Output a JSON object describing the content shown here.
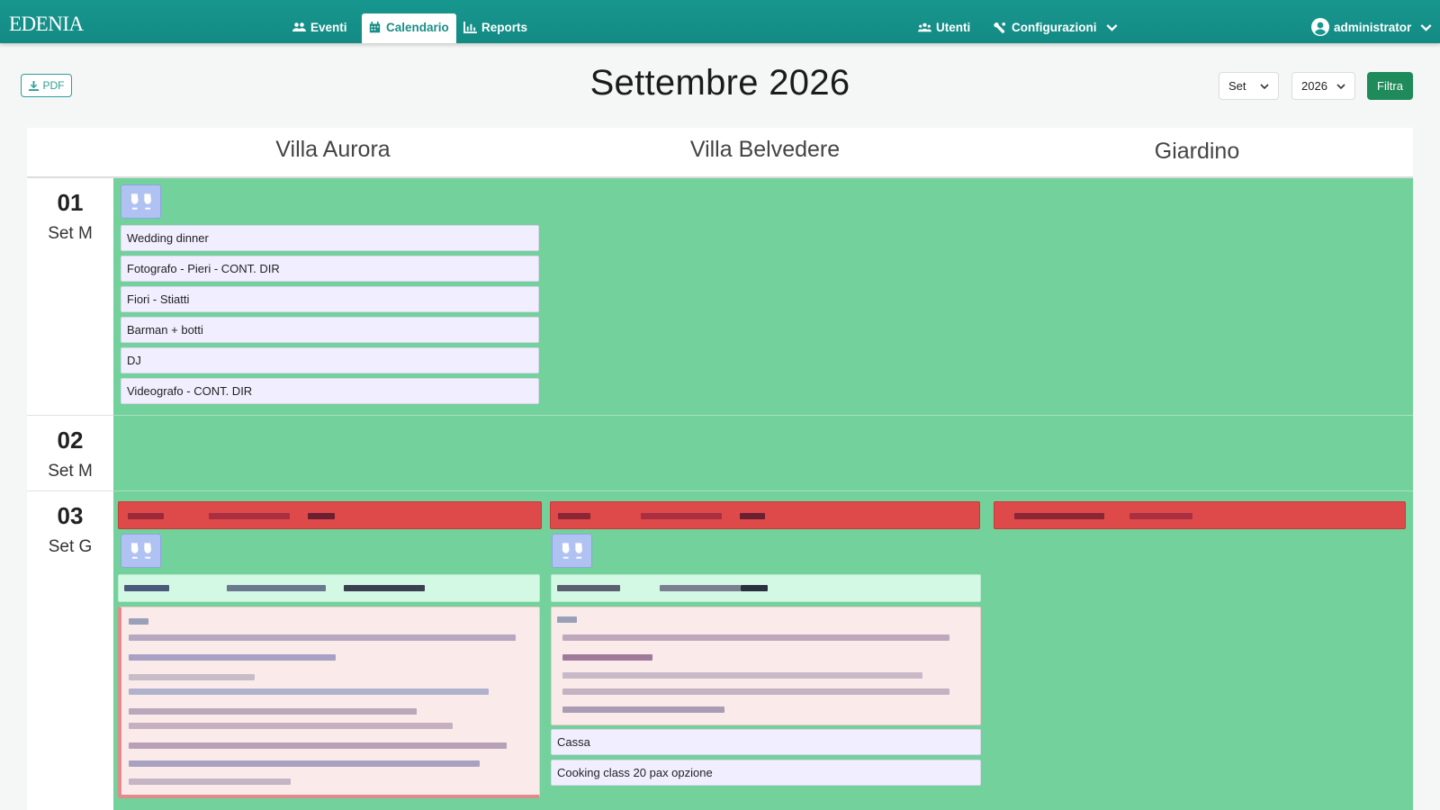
{
  "brand": "EDENIA",
  "nav": {
    "eventi": "Eventi",
    "calendario": "Calendario",
    "reports": "Reports",
    "utenti": "Utenti",
    "configurazioni": "Configurazioni",
    "user": "administrator"
  },
  "toolbar": {
    "pdf_label": "PDF",
    "title": "Settembre 2026",
    "month_select": "Set",
    "year_select": "2026",
    "filter_label": "Filtra"
  },
  "columns": [
    "Villa Aurora",
    "Villa Belvedere",
    "Giardino"
  ],
  "days": [
    {
      "num": "01",
      "label": "Set M",
      "events": {
        "villa_aurora": [
          "Wedding dinner",
          "Fotografo - Pieri - CONT. DIR",
          "Fiori - Stiatti",
          "Barman + botti",
          "DJ",
          "Videografo - CONT. DIR"
        ]
      }
    },
    {
      "num": "02",
      "label": "Set M"
    },
    {
      "num": "03",
      "label": "Set G",
      "events": {
        "villa_belvedere": [
          "Cassa",
          "Cooking class 20 pax opzione"
        ]
      }
    }
  ],
  "colors": {
    "navbar": "#17978f",
    "available": "#73d19b",
    "booked": "#de4a4a",
    "event_card": "#f1efff",
    "icon_box": "#b0c2f2",
    "filter_button": "#1f8a5a"
  },
  "icons": [
    "users-icon",
    "calendar-icon",
    "chart-icon",
    "user-group-icon",
    "tools-icon",
    "user-circle-icon",
    "chevron-down-icon",
    "download-icon",
    "glasses-toast-icon"
  ]
}
